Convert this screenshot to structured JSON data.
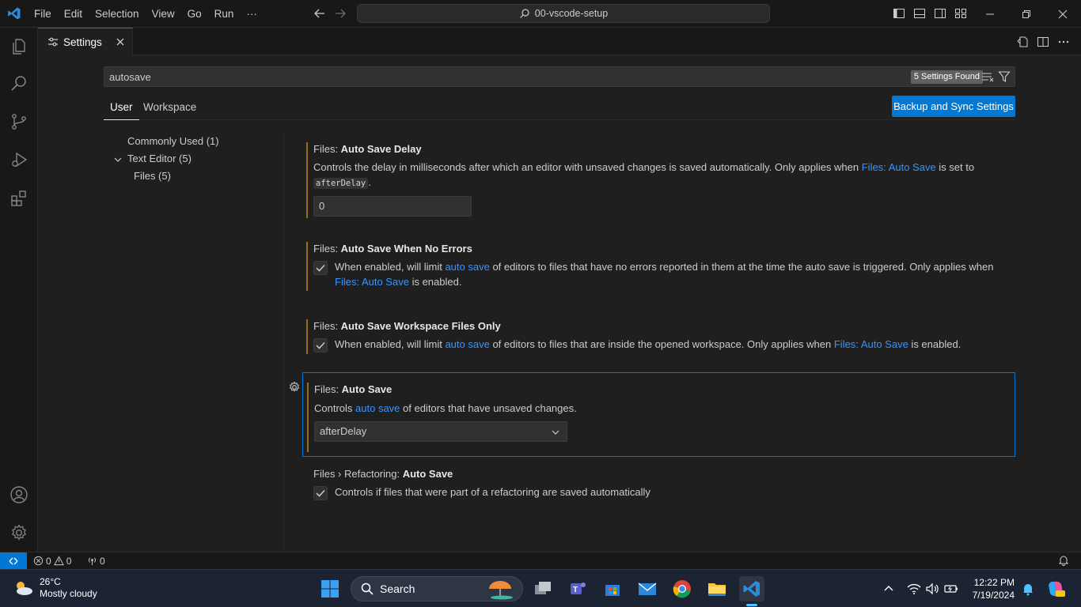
{
  "titlebar": {
    "menu": [
      "File",
      "Edit",
      "Selection",
      "View",
      "Go",
      "Run",
      "···"
    ],
    "search_text": "00-vscode-setup"
  },
  "tab": {
    "label": "Settings"
  },
  "settings": {
    "search_value": "autosave",
    "found_badge": "5 Settings Found",
    "scope_tabs": [
      "User",
      "Workspace"
    ],
    "backup_button": "Backup and Sync Settings",
    "toc": [
      "Commonly Used (1)",
      "Text Editor (5)",
      "Files (5)"
    ],
    "items": [
      {
        "category": "Files: ",
        "name": "Auto Save Delay",
        "desc_pre": "Controls the delay in milliseconds after which an editor with unsaved changes is saved automatically. Only applies when ",
        "desc_link": "Files: Auto Save",
        "desc_post": " is set to",
        "desc_code": "afterDelay",
        "desc_end": ".",
        "value": "0"
      },
      {
        "category": "Files: ",
        "name": "Auto Save When No Errors",
        "desc_pre": "When enabled, will limit ",
        "desc_link1": "auto save",
        "desc_mid": " of editors to files that have no errors reported in them at the time the auto save is triggered. Only applies when",
        "desc_link2": "Files: Auto Save",
        "desc_end": " is enabled.",
        "checked": true
      },
      {
        "category": "Files: ",
        "name": "Auto Save Workspace Files Only",
        "desc_pre": "When enabled, will limit ",
        "desc_link1": "auto save",
        "desc_mid": " of editors to files that are inside the opened workspace. Only applies when ",
        "desc_link2": "Files: Auto Save",
        "desc_end": " is enabled.",
        "checked": true
      },
      {
        "category": "Files: ",
        "name": "Auto Save",
        "desc_pre": "Controls ",
        "desc_link": "auto save",
        "desc_end": " of editors that have unsaved changes.",
        "value": "afterDelay"
      },
      {
        "category": "Files › Refactoring: ",
        "name": "Auto Save",
        "desc": "Controls if files that were part of a refactoring are saved automatically",
        "checked": true
      }
    ]
  },
  "statusbar": {
    "errors": "0",
    "warnings": "0",
    "ports": "0"
  },
  "taskbar": {
    "temperature": "26°C",
    "weather": "Mostly cloudy",
    "search": "Search",
    "time": "12:22 PM",
    "date": "7/19/2024"
  },
  "colors": {
    "accent": "#0078d4",
    "link": "#3794ff",
    "modified": "#9a6e15"
  }
}
